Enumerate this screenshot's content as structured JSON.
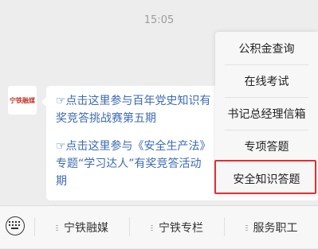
{
  "chat": {
    "timestamp": "15:05",
    "avatar_text": "宁铁融媒",
    "links": [
      "☞点击这里参与百年党史知识有\n奖竞答挑战赛第五期",
      "☞点击这里参与《安全生产法》\n专题“学习达人”有奖竞答活动\n期"
    ]
  },
  "popup_menu": {
    "items": [
      "公积金查询",
      "在线考试",
      "书记总经理信箱",
      "专项答题",
      "安全知识答题"
    ],
    "highlighted_index": 4,
    "highlight_color": "#e03030"
  },
  "bottom_bar": {
    "keyboard_icon": "keyboard-icon",
    "tabs": [
      "宁铁融媒",
      "宁铁专栏",
      "服务职工"
    ]
  }
}
